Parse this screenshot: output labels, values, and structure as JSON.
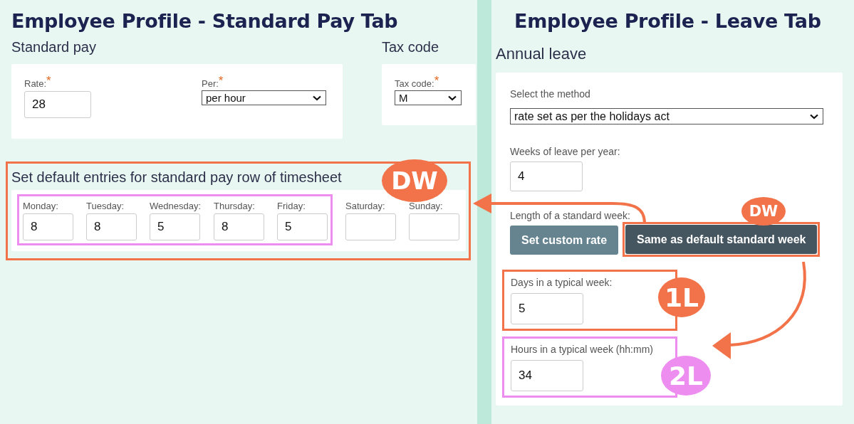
{
  "left": {
    "title": "Employee Profile - Standard Pay Tab",
    "standard_pay": {
      "heading": "Standard pay",
      "rate": {
        "label": "Rate:",
        "required_mark": "*",
        "value": "28"
      },
      "per": {
        "label": "Per:",
        "required_mark": "*",
        "value": "per hour"
      }
    },
    "tax_code": {
      "heading": "Tax code",
      "field": {
        "label": "Tax code:",
        "required_mark": "*",
        "value": "M"
      }
    },
    "defaults": {
      "heading": "Set default entries for standard pay row of timesheet",
      "badge": "DW",
      "days": [
        {
          "label": "Monday:",
          "value": "8",
          "highlighted": true
        },
        {
          "label": "Tuesday:",
          "value": "8",
          "highlighted": true
        },
        {
          "label": "Wednesday:",
          "value": "5",
          "highlighted": true
        },
        {
          "label": "Thursday:",
          "value": "8",
          "highlighted": true
        },
        {
          "label": "Friday:",
          "value": "5",
          "highlighted": true
        },
        {
          "label": "Saturday:",
          "highlighted": false
        },
        {
          "label": "Sunday:",
          "highlighted": false
        }
      ]
    }
  },
  "right": {
    "title": "Employee Profile - Leave Tab",
    "heading": "Annual leave",
    "method": {
      "label": "Select the method",
      "value": "rate set as per the holidays act"
    },
    "weeks": {
      "label": "Weeks of leave per year:",
      "value": "4"
    },
    "length": {
      "label": "Length of a standard week:",
      "badge": "DW",
      "buttons": [
        {
          "label": "Set custom rate",
          "selected": false
        },
        {
          "label": "Same as default standard week",
          "selected": true
        }
      ]
    },
    "days": {
      "label": "Days in a typical week:",
      "value": "5",
      "badge": "1L"
    },
    "hours": {
      "label": "Hours in a typical week (hh:mm)",
      "value": "34",
      "badge": "2L"
    }
  }
}
